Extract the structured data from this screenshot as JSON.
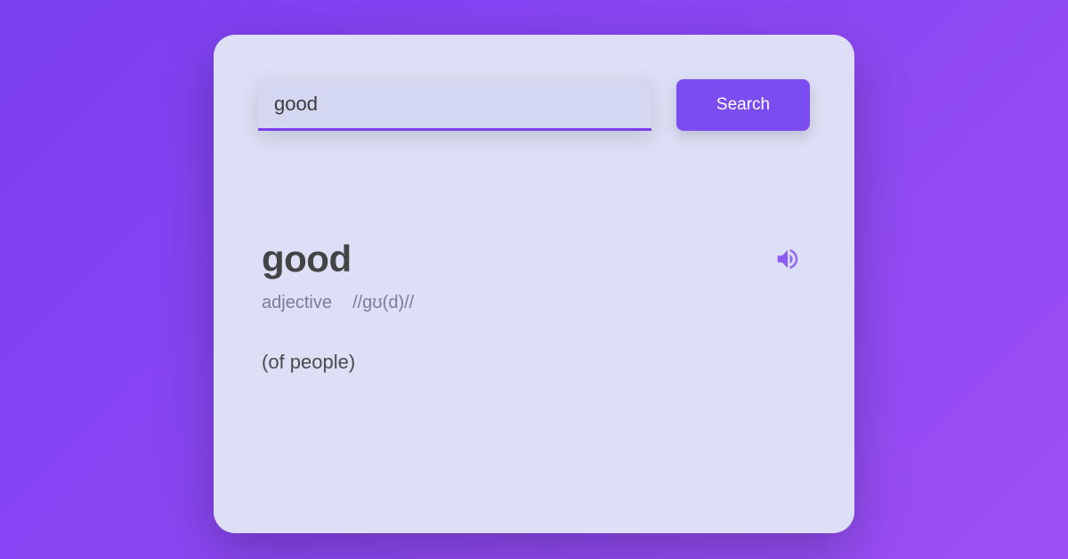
{
  "search": {
    "value": "good",
    "button_label": "Search"
  },
  "result": {
    "word": "good",
    "part_of_speech": "adjective",
    "phonetic": "//gʊ(d)//",
    "definition": "(of people)"
  },
  "colors": {
    "accent": "#7b3ff0"
  }
}
